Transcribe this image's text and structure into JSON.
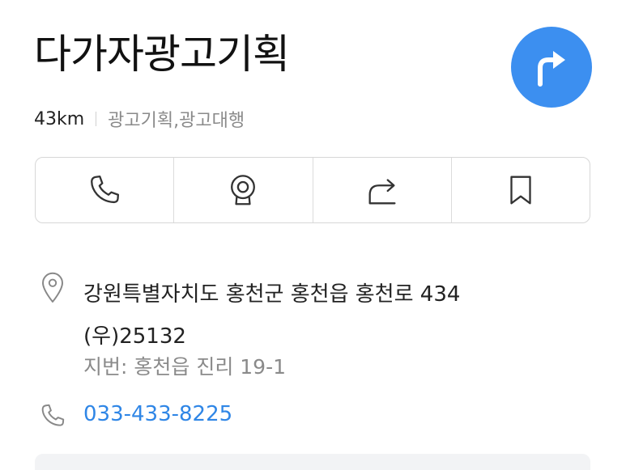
{
  "place": {
    "name": "다가자광고기획",
    "distance": "43km",
    "category": "광고기획,광고대행"
  },
  "address": {
    "road_line1": "강원특별자치도 홍천군 홍천읍 홍천로 434",
    "postal": "(우)25132",
    "jibun": "지번: 홍천읍 진리 19-1"
  },
  "contact": {
    "phone": "033-433-8225"
  },
  "colors": {
    "accent": "#3c8ff0",
    "link": "#2f86e6"
  },
  "icons": [
    "directions-arrow-icon",
    "phone-icon",
    "camera-icon",
    "share-icon",
    "bookmark-icon",
    "location-pin-icon"
  ]
}
